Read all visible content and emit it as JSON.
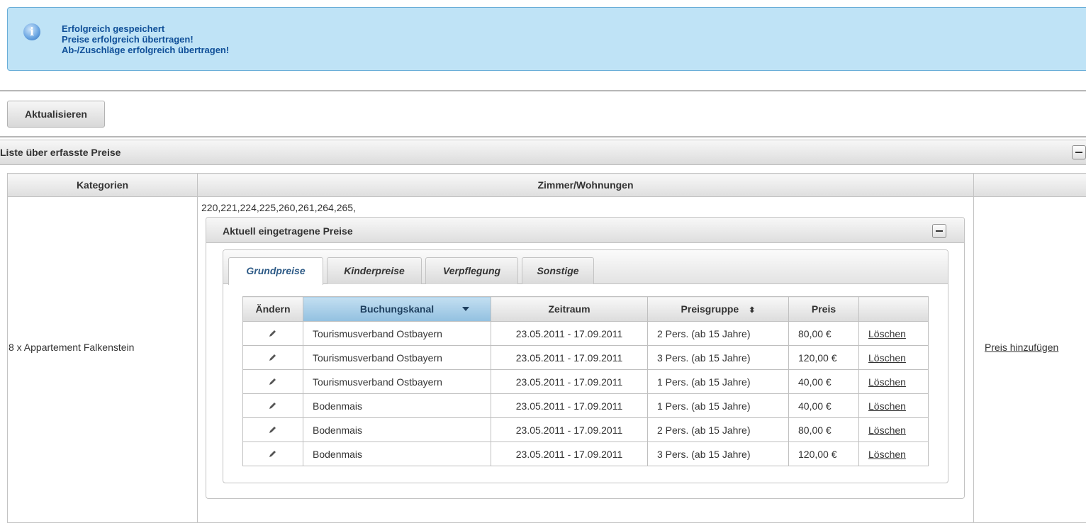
{
  "messages": [
    "Erfolgreich gespeichert",
    "Preise erfolgreich übertragen!",
    "Ab-/Zuschläge erfolgreich übertragen!"
  ],
  "toolbar": {
    "refresh_label": "Aktualisieren"
  },
  "section": {
    "title": "Liste über erfasste Preise"
  },
  "main_table": {
    "headers": [
      "Kategorien",
      "Zimmer/Wohnungen",
      ""
    ],
    "category": "8 x Appartement Falkenstein",
    "rooms": "220,221,224,225,260,261,264,265,",
    "add_price_label": "Preis hinzufügen"
  },
  "inner_panel": {
    "title": "Aktuell eingetragene Preise"
  },
  "tabs": [
    "Grundpreise",
    "Kinderpreise",
    "Verpflegung",
    "Sonstige"
  ],
  "active_tab": "Grundpreise",
  "price_table": {
    "headers": [
      "Ändern",
      "Buchungskanal",
      "Zeitraum",
      "Preisgruppe",
      "Preis",
      ""
    ],
    "delete_label": "Löschen",
    "rows": [
      {
        "channel": "Tourismusverband Ostbayern",
        "period": "23.05.2011 - 17.09.2011",
        "group": "2 Pers. (ab 15 Jahre)",
        "price": "80,00 €"
      },
      {
        "channel": "Tourismusverband Ostbayern",
        "period": "23.05.2011 - 17.09.2011",
        "group": "3 Pers. (ab 15 Jahre)",
        "price": "120,00 €"
      },
      {
        "channel": "Tourismusverband Ostbayern",
        "period": "23.05.2011 - 17.09.2011",
        "group": "1 Pers. (ab 15 Jahre)",
        "price": "40,00 €"
      },
      {
        "channel": "Bodenmais",
        "period": "23.05.2011 - 17.09.2011",
        "group": "1 Pers. (ab 15 Jahre)",
        "price": "40,00 €"
      },
      {
        "channel": "Bodenmais",
        "period": "23.05.2011 - 17.09.2011",
        "group": "2 Pers. (ab 15 Jahre)",
        "price": "80,00 €"
      },
      {
        "channel": "Bodenmais",
        "period": "23.05.2011 - 17.09.2011",
        "group": "3 Pers. (ab 15 Jahre)",
        "price": "120,00 €"
      }
    ]
  },
  "colors": {
    "info_bg": "#bfe3f6",
    "info_text": "#0f4f98",
    "sorted_header": "#92c0e0"
  }
}
